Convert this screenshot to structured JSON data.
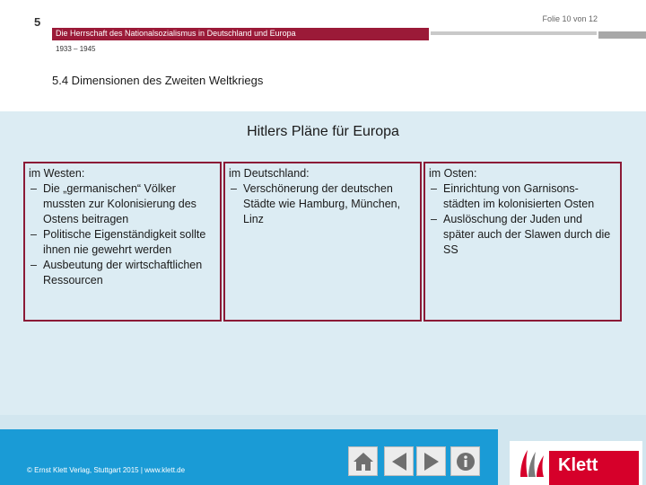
{
  "header": {
    "chapter_number": "5",
    "slide_counter": "Folie 10 von 12",
    "book_title": "Die Herrschaft des Nationalsozialismus in Deutschland und Europa",
    "period": "1933 – 1945",
    "section_title": "5.4 Dimensionen des Zweiten Weltkriegs"
  },
  "main": {
    "heading": "Hitlers Pläne für Europa",
    "panels": [
      {
        "title": "im Westen:",
        "items": [
          "Die „germanischen“ Völker mussten zur Kolonisierung des Ostens beitragen",
          "Politische Eigenständigkeit sollte ihnen nie gewehrt werden",
          "Ausbeutung der wirtschaftlichen Ressourcen"
        ]
      },
      {
        "title": "im Deutschland:",
        "items": [
          "Verschönerung der deutschen Städte wie Hamburg, München, Linz"
        ]
      },
      {
        "title": "im Osten:",
        "items": [
          "Einrichtung von Garnisons-städten im kolonisierten Osten",
          "Auslöschung der Juden und später auch der Slawen durch die SS"
        ]
      }
    ]
  },
  "footer": {
    "copyright": "© Ernst Klett Verlag, Stuttgart 2015 | www.klett.de",
    "nav_icons": [
      "home-icon",
      "previous-icon",
      "next-icon",
      "info-icon"
    ],
    "logo_text": "Klett"
  },
  "colors": {
    "accent_red": "#9b1a38",
    "content_bg": "#dcecf3",
    "footer_blue": "#1a9bd6",
    "klett_red": "#d6002a"
  }
}
